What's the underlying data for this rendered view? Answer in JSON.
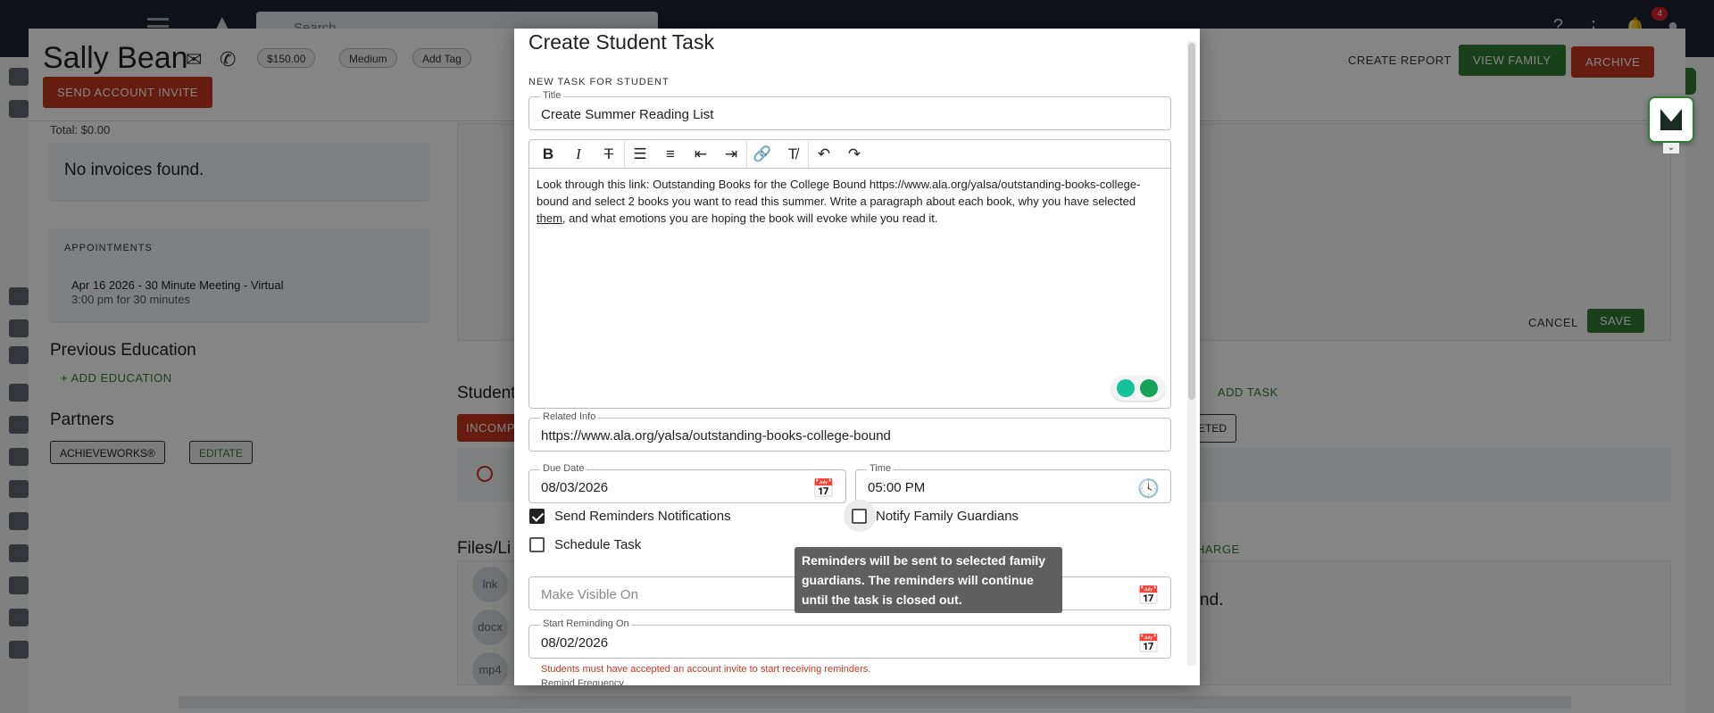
{
  "app": {
    "search_placeholder": "Search",
    "notification_count": "4"
  },
  "student": {
    "name": "Sally Bean",
    "balance": "$150.00",
    "priority": "Medium",
    "add_tag": "Add Tag",
    "send_invite": "SEND ACCOUNT INVITE"
  },
  "header_actions": {
    "create_report": "CREATE REPORT",
    "view_family": "VIEW FAMILY",
    "archive": "ARCHIVE"
  },
  "left": {
    "total": "Total: $0.00",
    "no_invoices": "No invoices found.",
    "appointments_title": "APPOINTMENTS",
    "appointment_line1": "Apr 16 2026 - 30 Minute Meeting - Virtual",
    "appointment_line2": "3:00 pm for 30 minutes",
    "previous_education": "Previous Education",
    "add_education": "ADD EDUCATION",
    "partners": "Partners",
    "partner1": "ACHIEVEWORKS®",
    "partner2": "EDITATE"
  },
  "middle": {
    "cancel": "CANCEL",
    "save": "SAVE",
    "student_heading": "Student",
    "incomplete": "INCOMPL",
    "add_task": "ADD TASK",
    "completed_fragment": "ETED",
    "files_heading": "Files/Li",
    "charge_fragment": "HARGE",
    "found_fragment": "nd.",
    "file_types": [
      "lnk",
      "docx",
      "mp4"
    ]
  },
  "modal": {
    "title": "Create Student Task",
    "subheading": "NEW TASK FOR STUDENT",
    "title_label": "Title",
    "title_value": "Create Summer Reading List",
    "body_text_1": "Look through this link: Outstanding Books for the College Bound https://www.ala.org/yalsa/outstanding-books-college-bound and select 2 books you want to read this summer. Write a paragraph about each book, why you have selected ",
    "body_text_underlined": "them",
    "body_text_2": ", and what emotions you are hoping the book will evoke while you read it.",
    "related_info_label": "Related Info",
    "related_info_value": "https://www.ala.org/yalsa/outstanding-books-college-bound",
    "due_date_label": "Due Date",
    "due_date_value": "08/03/2026",
    "time_label": "Time",
    "time_value": "05:00 PM",
    "send_reminders": "Send Reminders Notifications",
    "notify_guardians": "Notify Family Guardians",
    "schedule_task": "Schedule Task",
    "make_visible_placeholder": "Make Visible On",
    "start_reminding_label": "Start Reminding On",
    "start_reminding_value": "08/02/2026",
    "reminder_warning": "Students must have accepted an account invite to start receiving reminders.",
    "remind_frequency_label": "Remind Frequency",
    "tooltip": "Reminders will be sent to selected family guardians. The reminders will continue until the task is closed out."
  },
  "colors": {
    "primary_green": "#2e7d32",
    "danger_red": "#c6371f",
    "topbar": "#1f2330"
  }
}
